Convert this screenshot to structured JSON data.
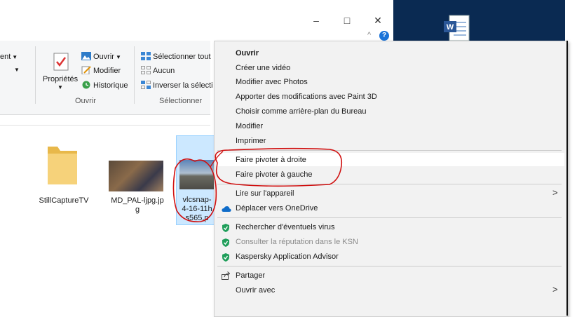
{
  "window": {
    "minimize_glyph": "–",
    "maximize_glyph": "□",
    "close_glyph": "✕",
    "ribbon_collapse_glyph": "^",
    "help_glyph": "?"
  },
  "ribbon": {
    "partial_left_label": "ent",
    "open_group": {
      "properties_label": "Propriétés",
      "open_label": "Ouvrir",
      "edit_label": "Modifier",
      "history_label": "Historique",
      "group_label": "Ouvrir"
    },
    "select_group": {
      "select_all_label": "Sélectionner tout",
      "select_none_label": "Aucun",
      "invert_label": "Inverser la sélecti",
      "group_label": "Sélectionner"
    }
  },
  "files": [
    {
      "name": "StillCaptureTV"
    },
    {
      "name_line1": "MD_PAL-ljpg.jp",
      "name_line2": "g"
    },
    {
      "name_line1": "vlcsnap-",
      "name_line2": "4-16-11h",
      "name_line3": "s565.p"
    }
  ],
  "context_menu": {
    "items": [
      {
        "label": "Ouvrir"
      },
      {
        "label": "Créer une vidéo"
      },
      {
        "label": "Modifier avec Photos"
      },
      {
        "label": "Apporter des modifications avec Paint 3D"
      },
      {
        "label": "Choisir comme arrière-plan du Bureau"
      },
      {
        "label": "Modifier"
      },
      {
        "label": "Imprimer"
      },
      {
        "label": "Faire pivoter à droite"
      },
      {
        "label": "Faire pivoter à gauche"
      },
      {
        "label": "Lire sur l'appareil"
      },
      {
        "label": "Déplacer vers OneDrive"
      },
      {
        "label": "Rechercher d'éventuels virus"
      },
      {
        "label": "Consulter la réputation dans le KSN"
      },
      {
        "label": "Kaspersky Application Advisor"
      },
      {
        "label": "Partager"
      },
      {
        "label": "Ouvrir avec"
      }
    ],
    "submenu_glyph": ">"
  },
  "colors": {
    "selection_fill": "#cce8ff",
    "menu_background": "#f2f2f2",
    "annotation_red": "#d01010",
    "kaspersky_green": "#1f9e5a",
    "onedrive_blue": "#0f6cc9",
    "help_blue": "#1a73d8"
  }
}
